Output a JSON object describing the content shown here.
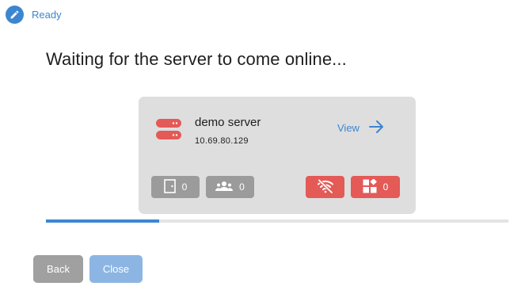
{
  "status": {
    "label": "Ready",
    "icon": "pencil-icon",
    "color": "#3d86cf"
  },
  "title": "Waiting for the server to come online...",
  "server": {
    "name": "demo server",
    "ip": "10.69.80.129",
    "icon": "server-icon",
    "view_label": "View",
    "stats": {
      "doors": {
        "icon": "door-icon",
        "count": "0"
      },
      "users": {
        "icon": "users-icon",
        "count": "0"
      },
      "connection": {
        "icon": "wifi-off-icon"
      },
      "apps": {
        "icon": "apps-icon",
        "count": "0"
      }
    }
  },
  "progress": {
    "fraction": 0.245
  },
  "buttons": {
    "back_label": "Back",
    "close_label": "Close"
  },
  "colors": {
    "accent": "#3d86cf",
    "danger": "#e35a57",
    "neutral": "#9b9b9b",
    "card": "#dedede"
  }
}
